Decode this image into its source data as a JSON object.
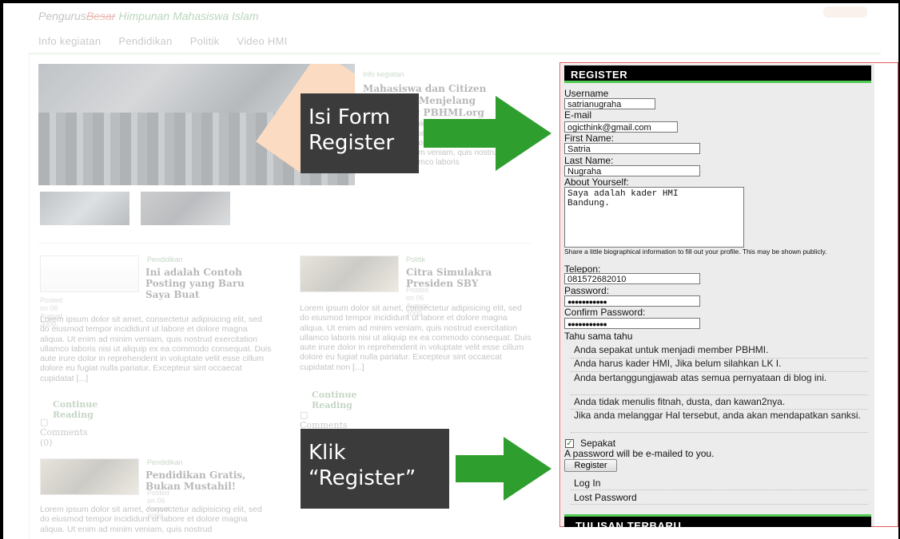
{
  "site": {
    "title_part1": "Pengurus",
    "title_part2": "Besar",
    "title_part3": "Himpunan Mahasiswa Islam"
  },
  "nav": [
    "Info kegiatan",
    "Pendidikan",
    "Politik",
    "Video HMI"
  ],
  "featured": {
    "category": "Info kegiatan",
    "title": "Mahasiswa dan Citizen Jurnalism Menjelang Launching PBHMI.org",
    "excerpt": "Lorem ipsum dolor sit amet, consectetur adipisicing elit, sed do eiusmod tempor incididunt ut labore et dolore magna aliqua. Ut enim ad minim veniam, quis nostrud exercitation ullamco laboris"
  },
  "posts": [
    {
      "category": "Pendidikan",
      "title": "Ini adalah Contoh Posting yang Baru Saya Buat",
      "date": "Posted on 06 August 2009",
      "body": "Lorem ipsum dolor sit amet, consectetur adipisicing elit, sed do eiusmod tempor incididunt ut labore et dolore magna aliqua. Ut enim ad minim veniam, quis nostrud exercitation ullamco laboris nisi ut aliquip ex ea commodo consequat. Duis aute irure dolor in reprehenderit in voluptate velit esse cillum dolore eu fugiat nulla pariatur. Excepteur sint occaecat cupidatat [...]",
      "continue": "Continue Reading",
      "comments": "Comments (0)"
    },
    {
      "category": "Politik",
      "title": "Citra Simulakra Presiden SBY",
      "date": "Posted on 06 August 2009",
      "body": "Lorem ipsum dolor sit amet, consectetur adipisicing elit, sed do eiusmod tempor incididunt ut labore et dolore magna aliqua. Ut enim ad minim veniam, quis nostrud exercitation ullamco laboris nisi ut aliquip ex ea commodo consequat. Duis aute irure dolor in reprehenderit in voluptate velit esse cillum dolore eu fugiat nulla pariatur. Excepteur sint occaecat cupidatat non [...]",
      "continue": "Continue Reading",
      "comments": "Comments (1)"
    },
    {
      "category": "Pendidikan",
      "title": "Pendidikan Gratis, Bukan Mustahil!",
      "date": "Posted on 06 August 2009",
      "body": "Lorem ipsum dolor sit amet, consectetur adipisicing elit, sed do eiusmod tempor incididunt ut labore et dolore magna aliqua. Ut enim ad minim veniam, quis nostrud"
    }
  ],
  "callouts": {
    "form": [
      "Isi Form",
      "Register"
    ],
    "click": [
      "Klik",
      "“Register”"
    ]
  },
  "register": {
    "header": "REGISTER",
    "username_label": "Username",
    "username": "satrianugraha",
    "email_label": "E-mail",
    "email": "ogicthink@gmail.com",
    "first_label": "First Name:",
    "first": "Satria",
    "last_label": "Last Name:",
    "last": "Nugraha",
    "about_label": "About Yourself:",
    "about": "Saya adalah kader HMI\nBandung.",
    "about_hint": "Share a little biographical information to fill out your profile. This may be shown publicly.",
    "phone_label": "Telepon:",
    "phone": "081572682010",
    "password_label": "Password:",
    "password": "●●●●●●●●●●●",
    "confirm_label": "Confirm Password:",
    "confirm": "●●●●●●●●●●●",
    "terms_title": "Tahu sama tahu",
    "terms": [
      "Anda sepakat untuk menjadi member PBHMI.",
      "Anda harus kader HMI, Jika belum silahkan LK I.",
      "Anda bertanggungjawab atas semua pernyataan di blog ini.",
      "Anda tidak menulis fitnah, dusta, dan kawan2nya.",
      "Jika anda melanggar Hal tersebut, anda akan mendapatkan sanksi."
    ],
    "agree_label": "Sepakat",
    "agree_checked": true,
    "email_note": "A password will be e-mailed to you.",
    "submit": "Register",
    "login": "Log In",
    "lost": "Lost Password"
  },
  "latest_header": "TULISAN TERBARU",
  "colors": {
    "header_bg": "#000000",
    "accent_green": "#55cc55",
    "frame_red": "#e05a5a",
    "callout_bg": "#3b3b3b",
    "arrow_green": "#2e9e2e"
  }
}
